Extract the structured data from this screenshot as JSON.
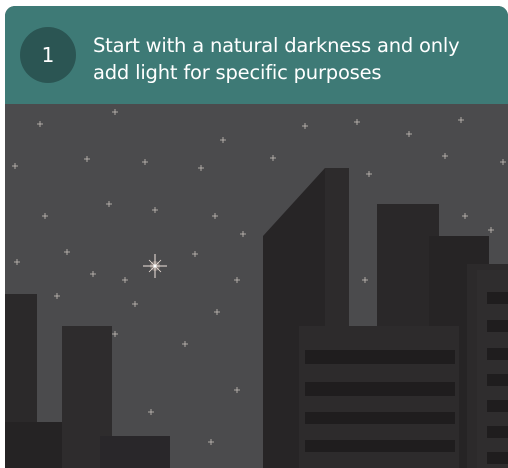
{
  "step": {
    "number": "1",
    "text": "Start with a natural darkness and only add light for specific purposes"
  },
  "colors": {
    "header": "#3e7a76",
    "badge": "#2b5553",
    "sky": "#4b4b4d",
    "building_dark": "#272526",
    "building_mid": "#2e2c2d",
    "window_band": "#1f1d1e",
    "star": "#f2e6df"
  },
  "illustration": {
    "subject": "night city skyline with stars",
    "icons": [
      "star-icon",
      "bright-star-icon"
    ]
  }
}
